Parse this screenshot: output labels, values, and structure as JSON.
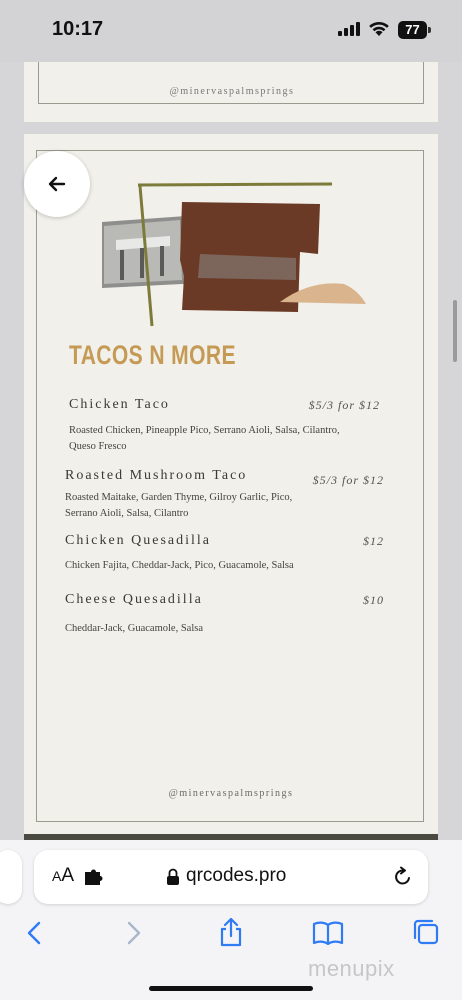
{
  "status_bar": {
    "time": "10:17",
    "battery": "77"
  },
  "prev_page": {
    "handle": "@minervaspalmsprings"
  },
  "menu": {
    "section_title": "TACOS N MORE",
    "items": [
      {
        "name": "Chicken Taco",
        "price": "$5/3 for $12",
        "description_line1": "Roasted Chicken, Pineapple Pico, Serrano Aioli, Salsa, Cilantro,",
        "description_line2": "Queso Fresco"
      },
      {
        "name": "Roasted Mushroom Taco",
        "price": "$5/3 for $12",
        "description_line1": "Roasted Maitake, Garden Thyme, Gilroy Garlic, Pico,",
        "description_line2": "Serrano Aioli, Salsa, Cilantro"
      },
      {
        "name": "Chicken Quesadilla",
        "price": "$12",
        "description_line1": "Chicken Fajita, Cheddar-Jack, Pico, Guacamole, Salsa",
        "description_line2": ""
      },
      {
        "name": "Cheese Quesadilla",
        "price": "$10",
        "description_line1": "Cheddar-Jack, Guacamole, Salsa",
        "description_line2": ""
      }
    ],
    "handle": "@minervaspalmsprings"
  },
  "browser": {
    "aa_label_big": "A",
    "aa_label_small": "A",
    "url": "qrcodes.pro",
    "icons": {
      "back": "back-arrow-icon",
      "address_ext": "extension-icon",
      "lock": "lock-icon",
      "reload": "reload-icon",
      "nav_back": "chevron-left-icon",
      "nav_forward": "chevron-right-icon",
      "share": "share-icon",
      "bookmarks": "book-icon",
      "tabs": "tabs-icon"
    }
  },
  "watermark": "menupix",
  "colors": {
    "title_gold": "#c49a55",
    "paper": "#f1f0ea",
    "collage_brown": "#6b3a26",
    "collage_olive": "#7d7b3a",
    "collage_sand": "#d9b48c"
  }
}
